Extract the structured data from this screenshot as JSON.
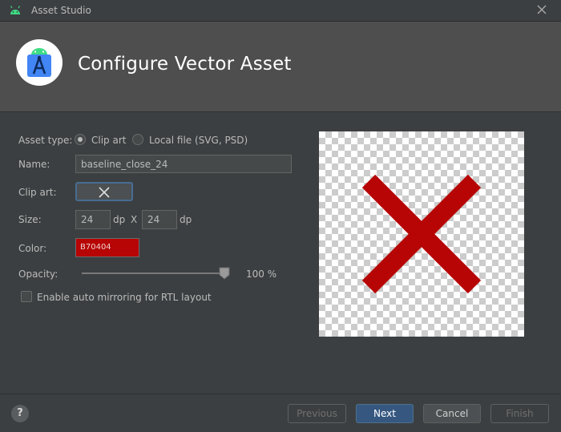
{
  "window": {
    "title": "Asset Studio"
  },
  "header": {
    "title": "Configure Vector Asset"
  },
  "form": {
    "asset_type_label": "Asset type:",
    "asset_type_options": [
      "Clip art",
      "Local file (SVG, PSD)"
    ],
    "asset_type_selected": "Clip art",
    "name_label": "Name:",
    "name_value": "baseline_close_24",
    "clip_art_label": "Clip art:",
    "clip_art_icon": "close-icon",
    "size_label": "Size:",
    "width": "24",
    "height": "24",
    "unit": "dp",
    "size_separator": "X",
    "color_label": "Color:",
    "color_value": "B70404",
    "color_hex": "#b70404",
    "opacity_label": "Opacity:",
    "opacity_value": "100 %",
    "opacity_level": 1.0,
    "rtl_label": "Enable auto mirroring for RTL layout",
    "rtl_checked": false
  },
  "preview": {
    "icon": "close-icon",
    "color": "#b70404"
  },
  "footer": {
    "help": "?",
    "previous": "Previous",
    "next": "Next",
    "cancel": "Cancel",
    "finish": "Finish"
  }
}
